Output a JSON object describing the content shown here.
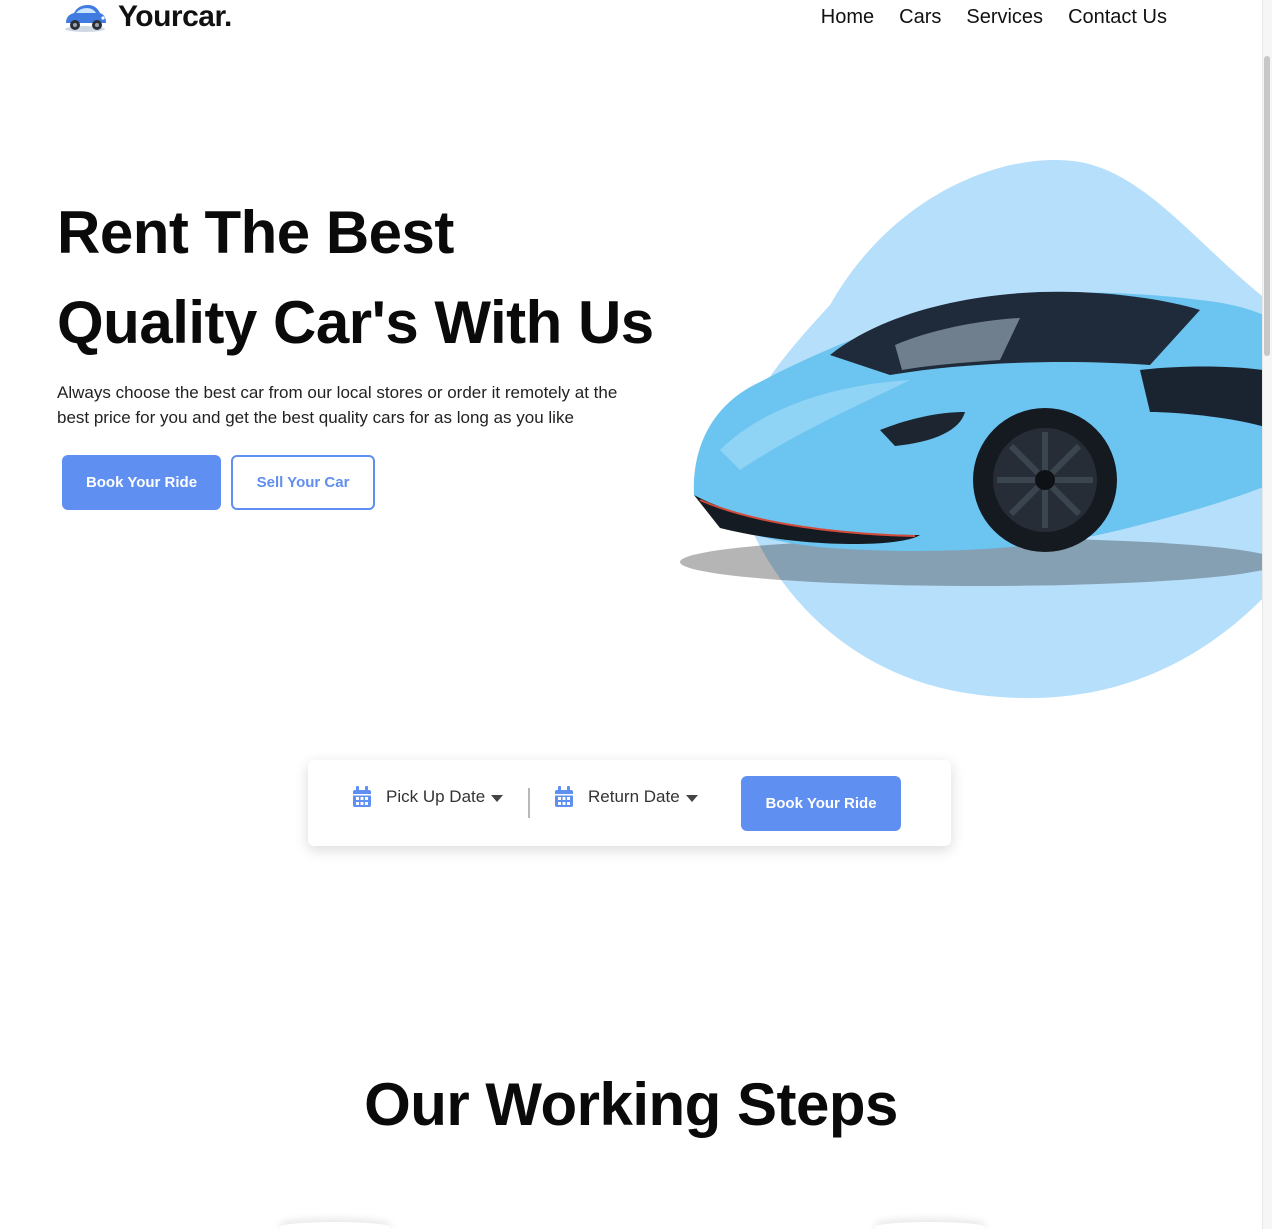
{
  "brand": {
    "name": "Yourcar.",
    "logo_icon": "blue-car-logo-icon"
  },
  "nav": {
    "items": [
      {
        "label": "Home"
      },
      {
        "label": "Cars"
      },
      {
        "label": "Services"
      },
      {
        "label": "Contact Us"
      }
    ]
  },
  "hero": {
    "title_line1": "Rent The Best",
    "title_line2": "Quality Car's With Us",
    "description": "Always choose the best car from our local stores or order it remotely at the best price for you and get the best quality cars for as long as you like",
    "primary_button": "Book Your Ride",
    "secondary_button": "Sell Your Car",
    "image": "blue-sports-car"
  },
  "booking": {
    "pickup_label": "Pick Up Date",
    "return_label": "Return Date",
    "button_label": "Book Your Ride",
    "icons": [
      "calendar-icon",
      "caret-down-icon"
    ]
  },
  "steps": {
    "title": "Our Working Steps"
  },
  "colors": {
    "accent": "#5f8ff0",
    "blob": "#b6dffb",
    "car_body": "#6cc4f0"
  }
}
